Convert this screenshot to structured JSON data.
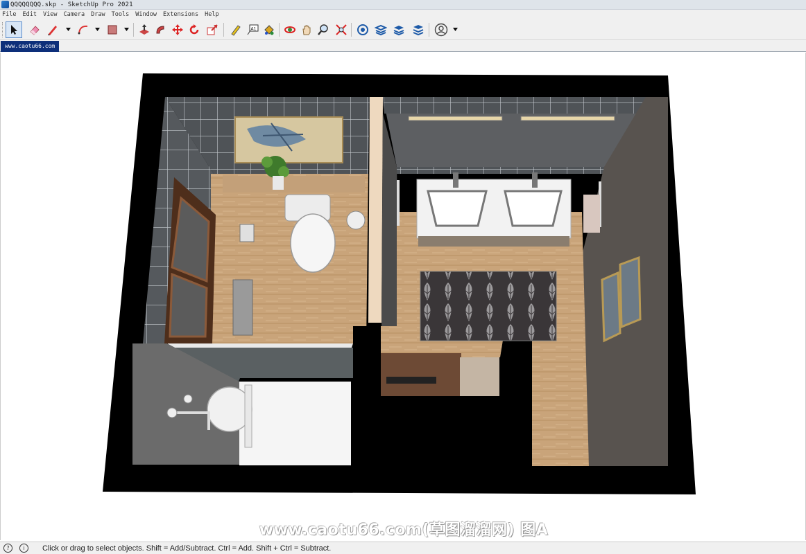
{
  "window": {
    "title": "QQQQQQQQ.skp - SketchUp Pro 2021"
  },
  "menu": [
    "File",
    "Edit",
    "View",
    "Camera",
    "Draw",
    "Tools",
    "Window",
    "Extensions",
    "Help"
  ],
  "toolbar": {
    "tools": [
      "select-icon",
      "eraser-icon",
      "pencil-line-icon",
      "arc-icon",
      "rectangle-icon",
      "push-pull-icon",
      "follow-me-icon",
      "move-icon",
      "rotate-icon",
      "scale-icon",
      "tape-measure-icon",
      "text-icon",
      "paint-bucket-icon",
      "orbit-icon",
      "pan-icon",
      "zoom-icon",
      "zoom-extents-icon",
      "warehouse-icon",
      "extension-warehouse-icon",
      "layout-icon",
      "extension-manager-icon",
      "account-icon"
    ],
    "active_tool": "select-icon"
  },
  "scene_tab": {
    "label": "www.caotu66.com"
  },
  "viewport": {
    "watermark": "www.caotu66.com(草图溜溜网) 图A",
    "colors": {
      "wall": "#000000",
      "floor": "#c9a57c",
      "tile": "#4f5357",
      "grout": "#bfc4c9",
      "wall_grey": "#6b6b6b"
    }
  },
  "status": {
    "icon": "info-icon",
    "text": "Click or drag to select objects. Shift = Add/Subtract. Ctrl = Add. Shift + Ctrl = Subtract."
  }
}
